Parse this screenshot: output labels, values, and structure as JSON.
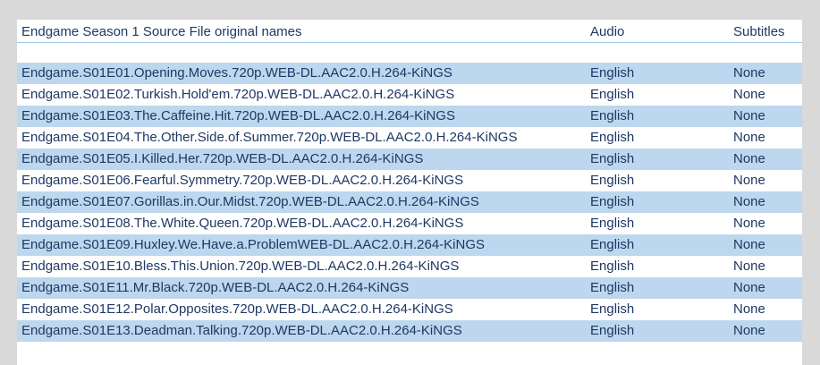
{
  "header": {
    "title": "Endgame Season 1 Source File original names",
    "audio": "Audio",
    "subtitles": "Subtitles"
  },
  "rows": [
    {
      "name": "Endgame.S01E01.Opening.Moves.720p.WEB-DL.AAC2.0.H.264-KiNGS",
      "audio": "English",
      "subtitles": "None"
    },
    {
      "name": "Endgame.S01E02.Turkish.Hold'em.720p.WEB-DL.AAC2.0.H.264-KiNGS",
      "audio": "English",
      "subtitles": "None"
    },
    {
      "name": "Endgame.S01E03.The.Caffeine.Hit.720p.WEB-DL.AAC2.0.H.264-KiNGS",
      "audio": "English",
      "subtitles": "None"
    },
    {
      "name": "Endgame.S01E04.The.Other.Side.of.Summer.720p.WEB-DL.AAC2.0.H.264-KiNGS",
      "audio": "English",
      "subtitles": "None"
    },
    {
      "name": "Endgame.S01E05.I.Killed.Her.720p.WEB-DL.AAC2.0.H.264-KiNGS",
      "audio": "English",
      "subtitles": "None"
    },
    {
      "name": "Endgame.S01E06.Fearful.Symmetry.720p.WEB-DL.AAC2.0.H.264-KiNGS",
      "audio": "English",
      "subtitles": "None"
    },
    {
      "name": "Endgame.S01E07.Gorillas.in.Our.Midst.720p.WEB-DL.AAC2.0.H.264-KiNGS",
      "audio": "English",
      "subtitles": "None"
    },
    {
      "name": "Endgame.S01E08.The.White.Queen.720p.WEB-DL.AAC2.0.H.264-KiNGS",
      "audio": "English",
      "subtitles": "None"
    },
    {
      "name": "Endgame.S01E09.Huxley.We.Have.a.ProblemWEB-DL.AAC2.0.H.264-KiNGS",
      "audio": "English",
      "subtitles": "None"
    },
    {
      "name": "Endgame.S01E10.Bless.This.Union.720p.WEB-DL.AAC2.0.H.264-KiNGS",
      "audio": "English",
      "subtitles": "None"
    },
    {
      "name": "Endgame.S01E11.Mr.Black.720p.WEB-DL.AAC2.0.H.264-KiNGS",
      "audio": "English",
      "subtitles": "None"
    },
    {
      "name": "Endgame.S01E12.Polar.Opposites.720p.WEB-DL.AAC2.0.H.264-KiNGS",
      "audio": "English",
      "subtitles": "None"
    },
    {
      "name": "Endgame.S01E13.Deadman.Talking.720p.WEB-DL.AAC2.0.H.264-KiNGS",
      "audio": "English",
      "subtitles": "None"
    }
  ]
}
